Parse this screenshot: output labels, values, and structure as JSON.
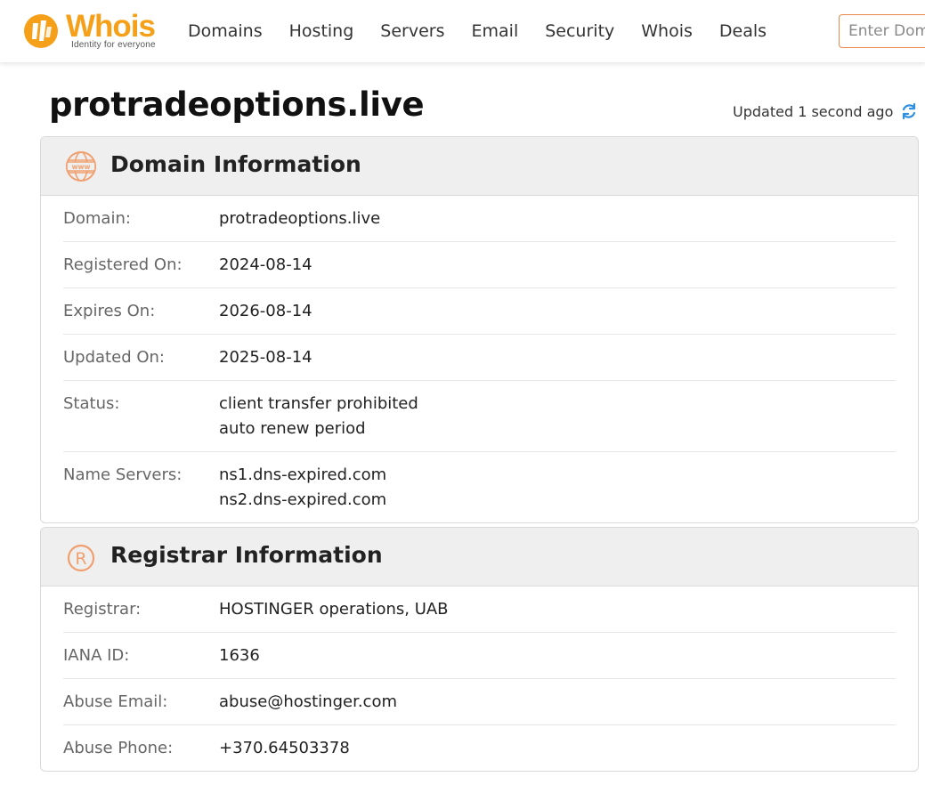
{
  "brand": {
    "name": "Whois",
    "tagline": "Identity for everyone"
  },
  "nav": [
    "Domains",
    "Hosting",
    "Servers",
    "Email",
    "Security",
    "Whois",
    "Deals"
  ],
  "search": {
    "placeholder": "Enter Domain"
  },
  "page": {
    "title": "protradeoptions.live",
    "updated": "Updated 1 second ago"
  },
  "domain_info": {
    "title": "Domain Information",
    "rows": [
      {
        "label": "Domain:",
        "values": [
          "protradeoptions.live"
        ]
      },
      {
        "label": "Registered On:",
        "values": [
          "2024-08-14"
        ]
      },
      {
        "label": "Expires On:",
        "values": [
          "2026-08-14"
        ]
      },
      {
        "label": "Updated On:",
        "values": [
          "2025-08-14"
        ]
      },
      {
        "label": "Status:",
        "values": [
          "client transfer prohibited",
          "auto renew period"
        ]
      },
      {
        "label": "Name Servers:",
        "values": [
          "ns1.dns-expired.com",
          "ns2.dns-expired.com"
        ]
      }
    ]
  },
  "registrar_info": {
    "title": "Registrar Information",
    "rows": [
      {
        "label": "Registrar:",
        "values": [
          "HOSTINGER operations, UAB"
        ]
      },
      {
        "label": "IANA ID:",
        "values": [
          "1636"
        ]
      },
      {
        "label": "Abuse Email:",
        "values": [
          "abuse@hostinger.com"
        ]
      },
      {
        "label": "Abuse Phone:",
        "values": [
          "+370.64503378"
        ]
      }
    ]
  },
  "colors": {
    "accent": "#f6a01a",
    "icon_orange": "#f0a070",
    "refresh_blue": "#2f8fe0"
  }
}
